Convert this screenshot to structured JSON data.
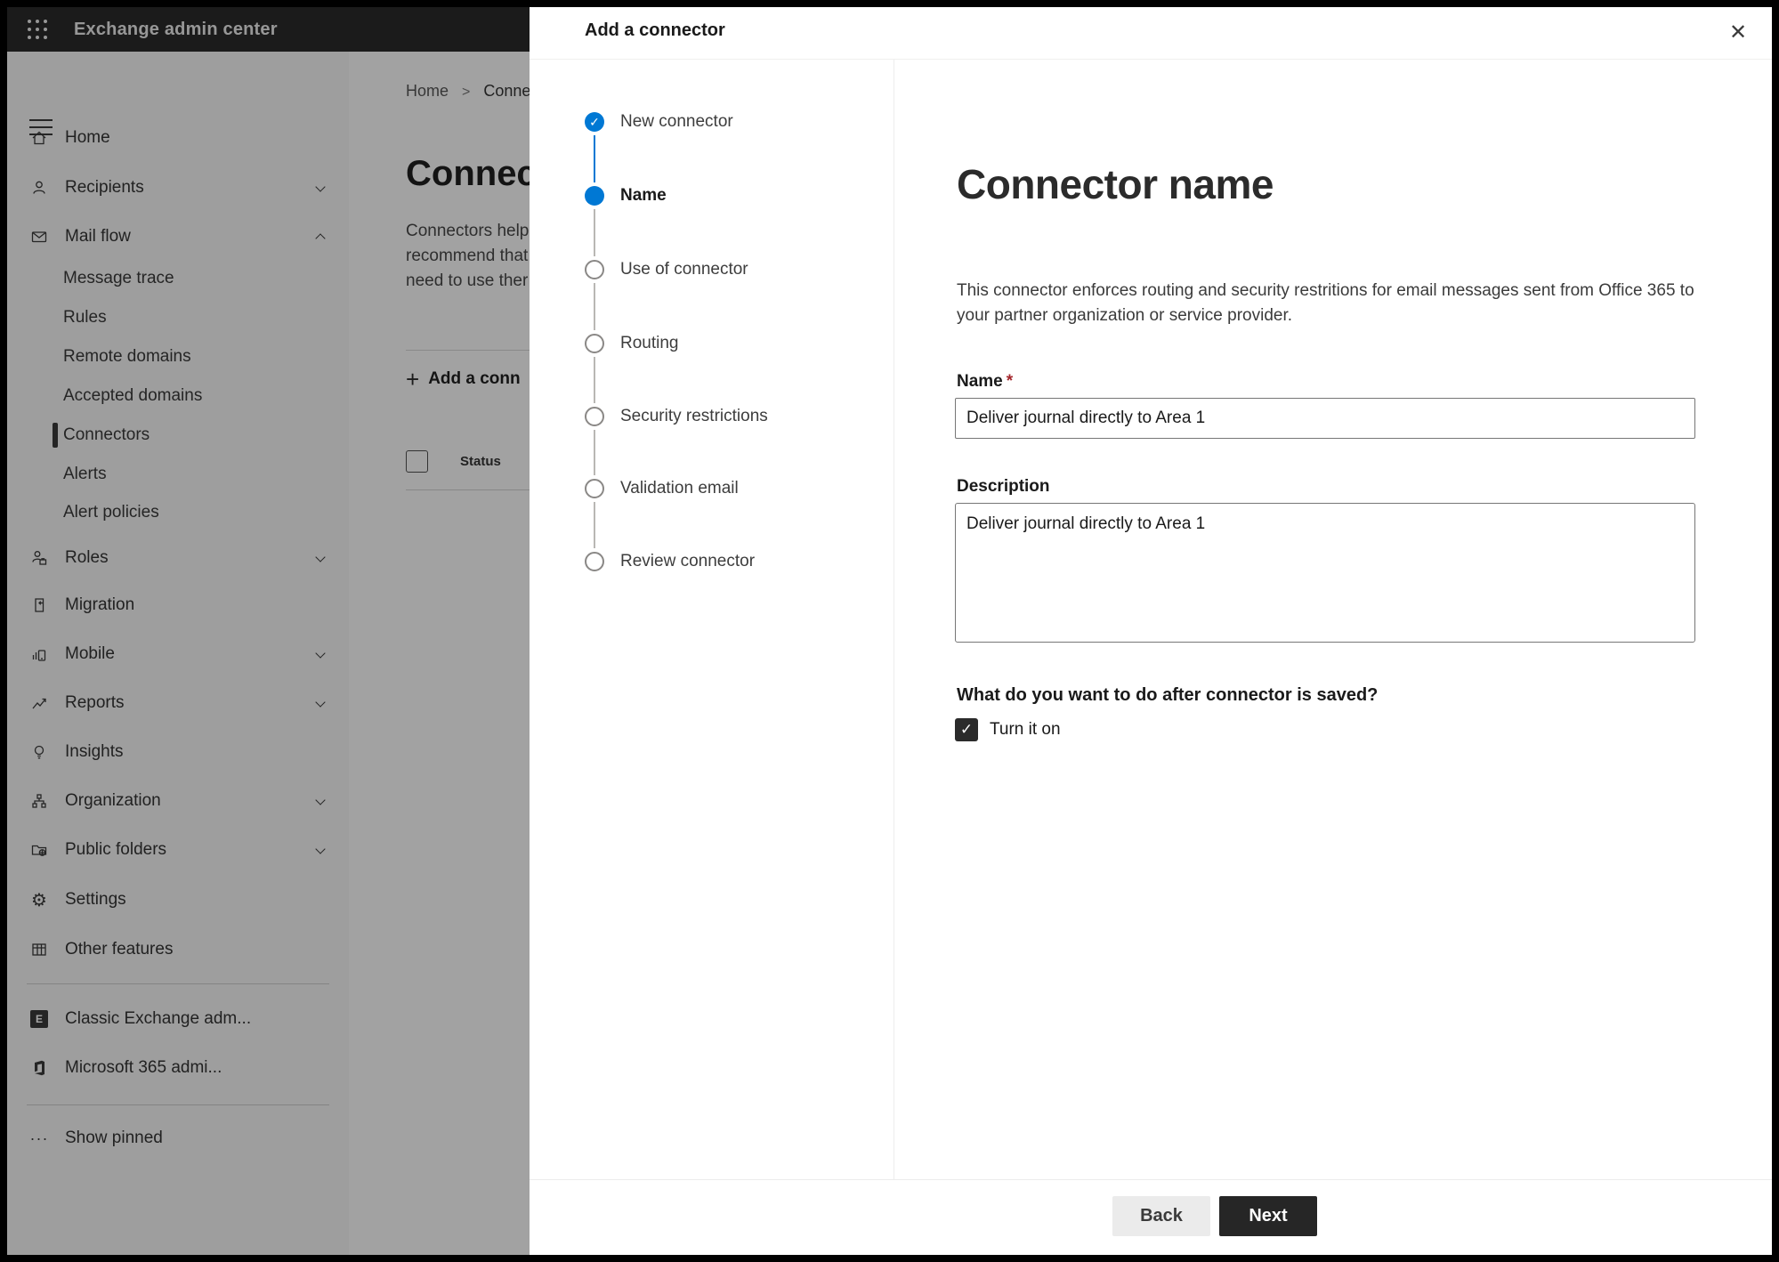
{
  "icons": {
    "check": "✓",
    "close": "✕",
    "add": "+",
    "breadcrumb_separator": ">",
    "ellipsis_menu": "···",
    "gear": "⚙",
    "exchange_badge": "E"
  },
  "topbar": {
    "title": "Exchange admin center"
  },
  "sidebar": {
    "items": [
      {
        "label": "Home"
      },
      {
        "label": "Recipients",
        "expandable": true
      },
      {
        "label": "Mail flow",
        "expandable": true,
        "expanded": true
      },
      {
        "label": "Roles",
        "expandable": true
      },
      {
        "label": "Migration"
      },
      {
        "label": "Mobile",
        "expandable": true
      },
      {
        "label": "Reports",
        "expandable": true
      },
      {
        "label": "Insights"
      },
      {
        "label": "Organization",
        "expandable": true
      },
      {
        "label": "Public folders",
        "expandable": true
      },
      {
        "label": "Settings"
      },
      {
        "label": "Other features"
      }
    ],
    "mail_flow_children": [
      {
        "label": "Message trace"
      },
      {
        "label": "Rules"
      },
      {
        "label": "Remote domains"
      },
      {
        "label": "Accepted domains"
      },
      {
        "label": "Connectors",
        "selected": true
      },
      {
        "label": "Alerts"
      },
      {
        "label": "Alert policies"
      }
    ],
    "footer_items": [
      {
        "label": "Classic Exchange adm..."
      },
      {
        "label": "Microsoft 365 admi..."
      },
      {
        "label": "Show pinned"
      }
    ]
  },
  "page": {
    "breadcrumb": {
      "root": "Home",
      "current": "Conne"
    },
    "title": "Connect",
    "intro_lines": [
      "Connectors help",
      "recommend that",
      "need to use ther"
    ],
    "add_connector_button": "Add a conn",
    "status_column": "Status"
  },
  "dialog": {
    "title": "Add a connector",
    "steps": [
      {
        "label": "New connector",
        "state": "completed"
      },
      {
        "label": "Name",
        "state": "current"
      },
      {
        "label": "Use of connector",
        "state": "upcoming"
      },
      {
        "label": "Routing",
        "state": "upcoming"
      },
      {
        "label": "Security restrictions",
        "state": "upcoming"
      },
      {
        "label": "Validation email",
        "state": "upcoming"
      },
      {
        "label": "Review connector",
        "state": "upcoming"
      }
    ],
    "content": {
      "heading": "Connector name",
      "description": "This connector enforces routing and security restritions for email messages sent from Office 365 to your partner organization or service provider.",
      "name_label": "Name",
      "required_mark": "*",
      "name_value": "Deliver journal directly to Area 1",
      "description_label": "Description",
      "description_value": "Deliver journal directly to Area 1",
      "after_save_question": "What do you want to do after connector is saved?",
      "turn_on_label": "Turn it on",
      "turn_on_checked": true
    },
    "footer": {
      "back_label": "Back",
      "next_label": "Next"
    }
  },
  "colors": {
    "accent": "#0078d4",
    "required_asterisk": "#a4262c",
    "primary_button_bg": "#262626",
    "selected_indicator": "#3a3a3a"
  }
}
